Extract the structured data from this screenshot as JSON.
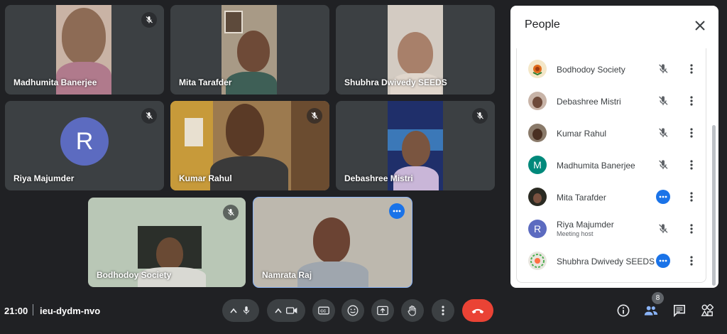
{
  "meeting": {
    "time": "21:00",
    "code": "ieu-dydm-nvo"
  },
  "tiles": [
    {
      "name": "Madhumita Banerjee",
      "muted": true
    },
    {
      "name": "Mita Tarafder",
      "muted": false
    },
    {
      "name": "Shubhra Dwivedy SEEDS",
      "muted": false
    },
    {
      "name": "Riya Majumder",
      "muted": true,
      "initial": "R"
    },
    {
      "name": "Kumar Rahul",
      "muted": true
    },
    {
      "name": "Debashree Mistri",
      "muted": true
    },
    {
      "name": "Bodhodoy Society",
      "muted": true
    },
    {
      "name": "Namrata Raj",
      "muted": false,
      "speaking": true
    }
  ],
  "people_panel": {
    "title": "People",
    "people": [
      {
        "name": "Bodhodoy Society",
        "status": "muted"
      },
      {
        "name": "Debashree Mistri",
        "status": "muted"
      },
      {
        "name": "Kumar Rahul",
        "status": "muted"
      },
      {
        "name": "Madhumita Banerjee",
        "status": "muted",
        "initial": "M"
      },
      {
        "name": "Mita Tarafder",
        "status": "active"
      },
      {
        "name": "Riya Majumder",
        "status": "muted",
        "initial": "R",
        "role": "Meeting host"
      },
      {
        "name": "Shubhra Dwivedy SEEDS",
        "status": "active"
      }
    ]
  },
  "participant_count": "8",
  "colors": {
    "accent": "#1a73e8",
    "hangup": "#ea4335",
    "background": "#202124",
    "tile": "#3c4043",
    "avatar_r": "#5c6bc0",
    "avatar_m": "#00897b"
  }
}
